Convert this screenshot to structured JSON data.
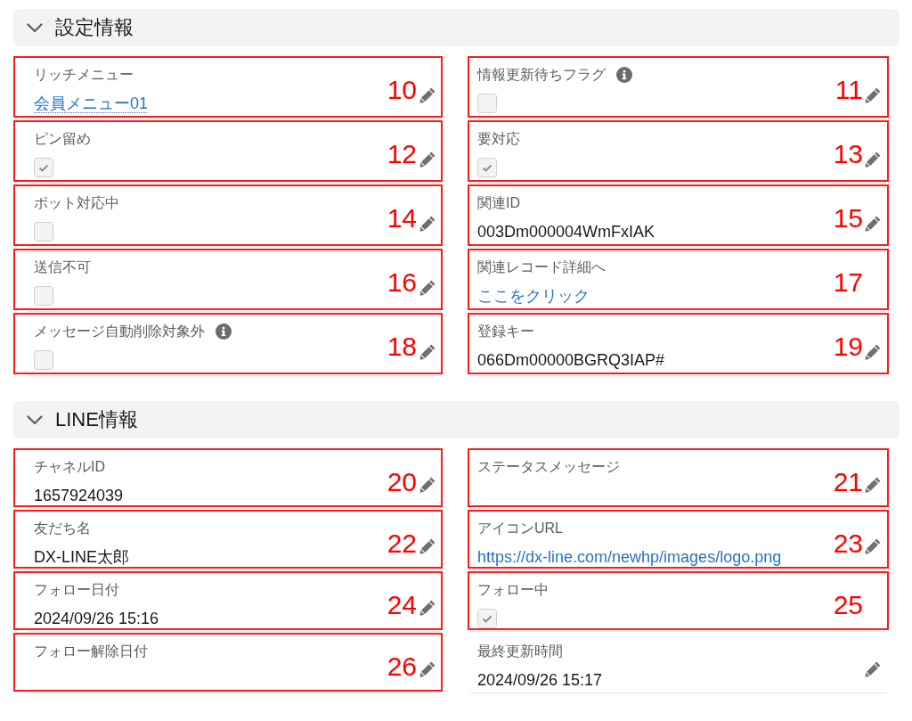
{
  "sections": [
    {
      "title": "設定情報",
      "expanded": true,
      "fields": [
        {
          "label": "リッチメニュー",
          "kind": "lookup",
          "value": "会員メニュー01",
          "editable": true,
          "callout": "10"
        },
        {
          "label": "情報更新待ちフラグ",
          "help_icon": true,
          "kind": "checkbox",
          "checked": false,
          "editable": true,
          "callout": "11"
        },
        {
          "label": "ピン留め",
          "kind": "checkbox",
          "checked": true,
          "editable": true,
          "callout": "12"
        },
        {
          "label": "要対応",
          "kind": "checkbox",
          "checked": true,
          "editable": true,
          "callout": "13"
        },
        {
          "label": "ボット対応中",
          "kind": "checkbox",
          "checked": false,
          "editable": true,
          "callout": "14"
        },
        {
          "label": "関連ID",
          "kind": "text",
          "value": "003Dm000004WmFxIAK",
          "editable": true,
          "callout": "15"
        },
        {
          "label": "送信不可",
          "kind": "checkbox",
          "checked": false,
          "editable": true,
          "callout": "16"
        },
        {
          "label": "関連レコード詳細へ",
          "kind": "link",
          "value": "ここをクリック",
          "editable": false,
          "callout": "17"
        },
        {
          "label": "メッセージ自動削除対象外",
          "help_icon": true,
          "kind": "checkbox",
          "checked": false,
          "editable": true,
          "callout": "18"
        },
        {
          "label": "登録キー",
          "kind": "text",
          "value": "066Dm00000BGRQ3IAP#",
          "editable": true,
          "callout": "19"
        }
      ]
    },
    {
      "title": "LINE情報",
      "expanded": true,
      "fields": [
        {
          "label": "チャネルID",
          "kind": "text",
          "value": "1657924039",
          "editable": true,
          "callout": "20"
        },
        {
          "label": "ステータスメッセージ",
          "kind": "text",
          "editable": true,
          "callout": "21"
        },
        {
          "label": "友だち名",
          "kind": "text",
          "value": "DX-LINE太郎",
          "editable": true,
          "callout": "22"
        },
        {
          "label": "アイコンURL",
          "kind": "link",
          "value": "https://dx-line.com/newhp/images/logo.png",
          "editable": true,
          "callout": "23"
        },
        {
          "label": "フォロー日付",
          "kind": "text",
          "value": "2024/09/26 15:16",
          "editable": true,
          "callout": "24"
        },
        {
          "label": "フォロー中",
          "kind": "checkbox",
          "checked": true,
          "editable": false,
          "callout": "25"
        },
        {
          "label": "フォロー解除日付",
          "kind": "text",
          "editable": true,
          "callout": "26"
        },
        {
          "label": "最終更新時間",
          "kind": "text",
          "value": "2024/09/26 15:17",
          "editable": true
        }
      ]
    }
  ]
}
